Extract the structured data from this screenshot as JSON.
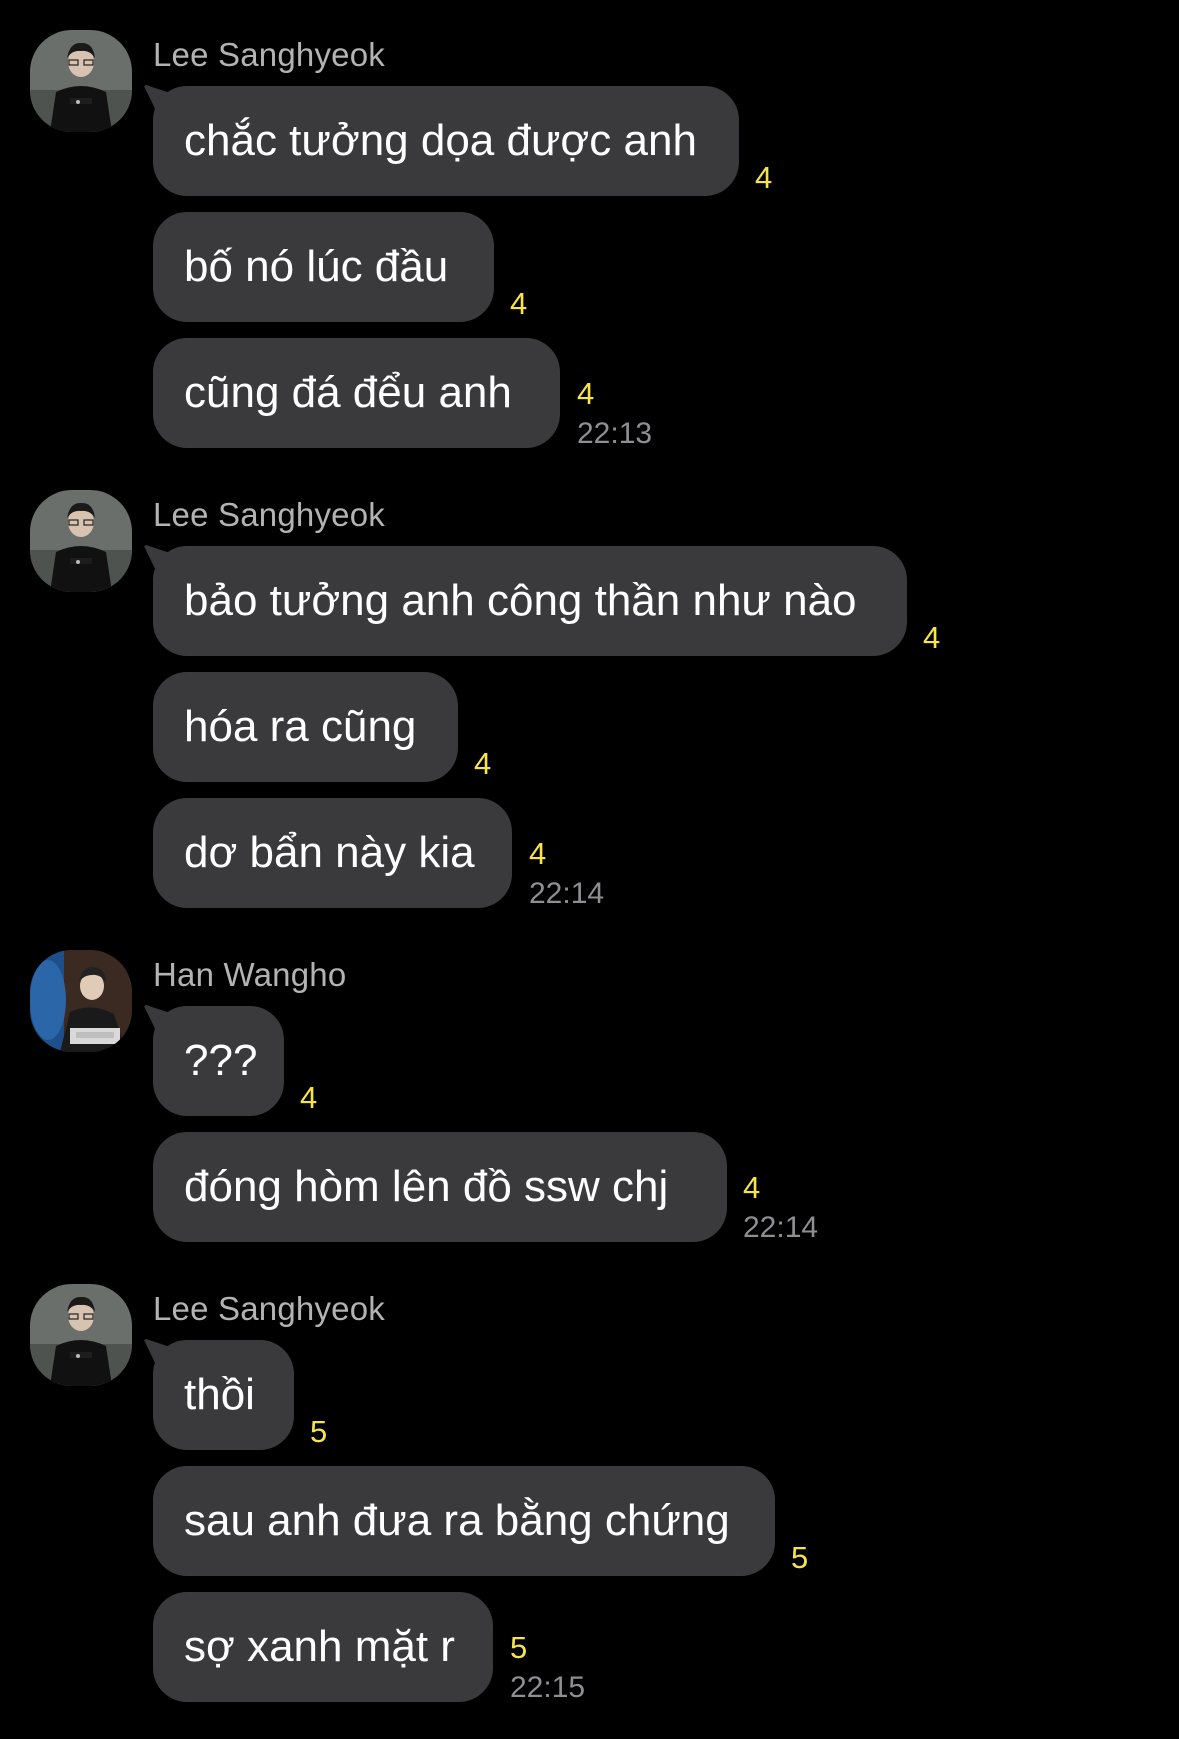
{
  "colors": {
    "background": "#000000",
    "bubble": "#3a3a3c",
    "unread_count": "#f7e34a",
    "timestamp": "#8e8e93",
    "sender_name": "#b3b3b3"
  },
  "groups": [
    {
      "sender": "Lee Sanghyeok",
      "avatar": "lee-sanghyeok-avatar",
      "time": "22:13",
      "messages": [
        {
          "text": "chắc tưởng dọa được anh",
          "count": "4"
        },
        {
          "text": "bố nó lúc đầu",
          "count": "4"
        },
        {
          "text": "cũng đá đểu anh",
          "count": "4"
        }
      ]
    },
    {
      "sender": "Lee Sanghyeok",
      "avatar": "lee-sanghyeok-avatar",
      "time": "22:14",
      "messages": [
        {
          "text": "bảo tưởng anh công thần như nào",
          "count": "4"
        },
        {
          "text": "hóa ra cũng",
          "count": "4"
        },
        {
          "text": "dơ bẩn này kia",
          "count": "4"
        }
      ]
    },
    {
      "sender": "Han Wangho",
      "avatar": "han-wangho-avatar",
      "time": "22:14",
      "messages": [
        {
          "text": "???",
          "count": "4"
        },
        {
          "text": "đóng hòm lên đồ ssw chj",
          "count": "4"
        }
      ]
    },
    {
      "sender": "Lee Sanghyeok",
      "avatar": "lee-sanghyeok-avatar",
      "time": "22:15",
      "messages": [
        {
          "text": "thồi",
          "count": "5"
        },
        {
          "text": "sau anh đưa ra bằng chứng",
          "count": "5"
        },
        {
          "text": "sợ xanh mặt r",
          "count": "5"
        }
      ]
    }
  ]
}
